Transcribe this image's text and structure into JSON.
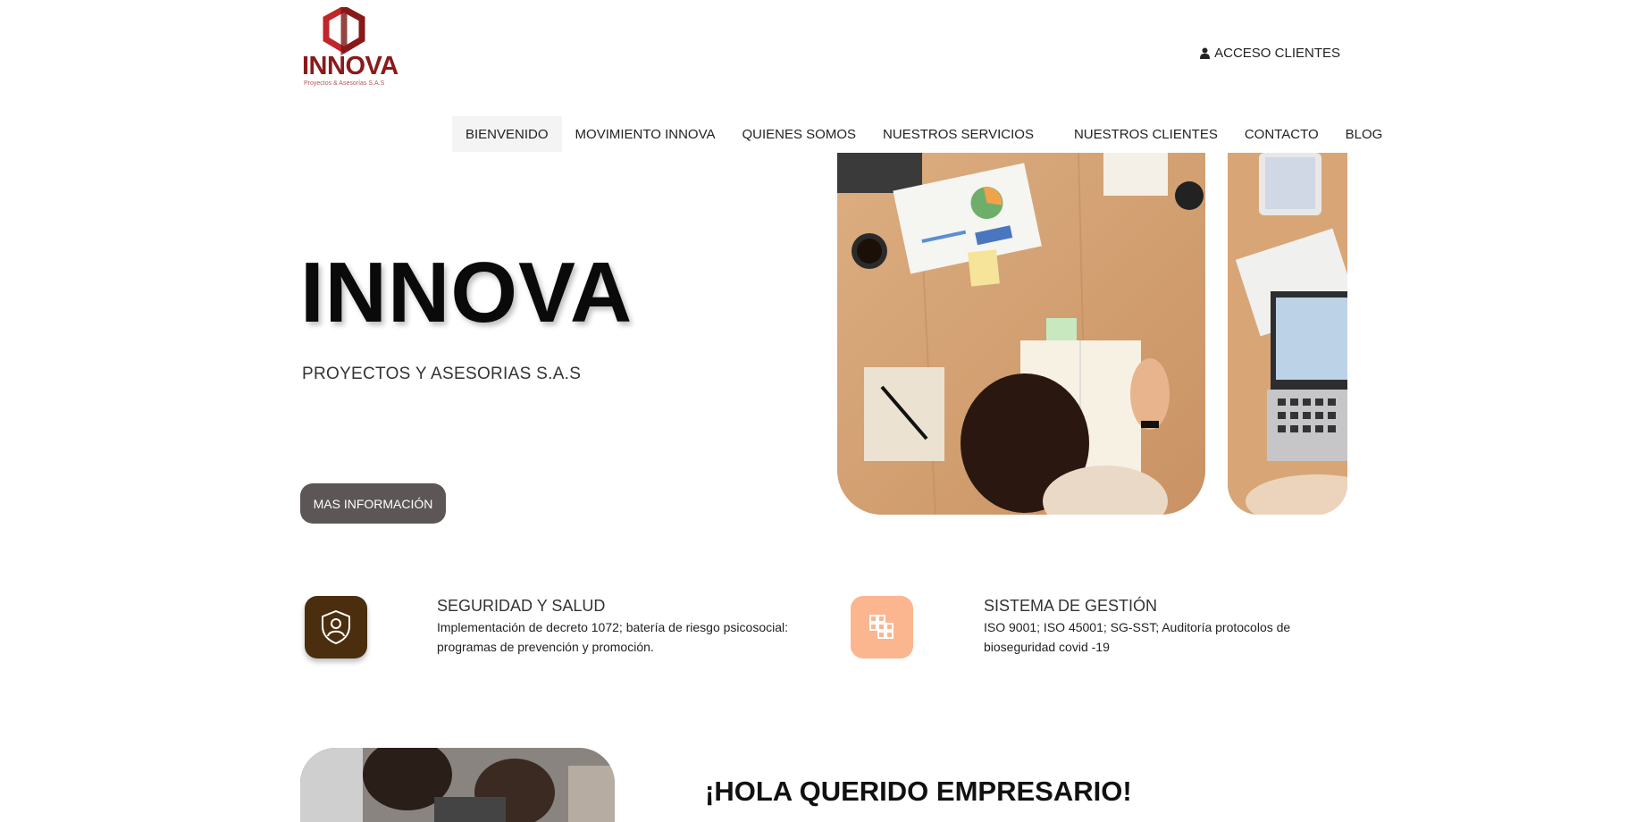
{
  "brand": {
    "name": "INNOVA",
    "tagline": "Proyectos & Asesorías S.A.S",
    "color": "#8b1a1a"
  },
  "header": {
    "acceso_label": "ACCESO CLIENTES",
    "acceso_icon": "user-icon"
  },
  "nav": {
    "items": [
      {
        "label": "BIENVENIDO",
        "active": true
      },
      {
        "label": "MOVIMIENTO INNOVA"
      },
      {
        "label": "QUIENES SOMOS"
      },
      {
        "label": "NUESTROS SERVICIOS"
      },
      {
        "label": "NUESTROS CLIENTES"
      },
      {
        "label": "CONTACTO"
      },
      {
        "label": "BLOG"
      }
    ]
  },
  "hero": {
    "title": "INNOVA",
    "subtitle": "PROYECTOS Y ASESORIAS S.A.S",
    "button_label": "MAS INFORMACIÓN",
    "button_color": "#5c5656"
  },
  "features": [
    {
      "title": "SEGURIDAD Y SALUD",
      "description": "Implementación de decreto 1072; batería de riesgo psicosocial: programas de prevención y promoción.",
      "icon": "shield-user-icon",
      "icon_bg": "#4a2e0e"
    },
    {
      "title": "SISTEMA DE GESTIÓN",
      "description": "ISO 9001; ISO 45001; SG-SST; Auditoría protocolos de bioseguridad covid -19",
      "icon": "grid-blocks-icon",
      "icon_bg": "#fbb58f"
    }
  ],
  "section": {
    "heading": "¡HOLA QUERIDO EMPRESARIO!"
  }
}
